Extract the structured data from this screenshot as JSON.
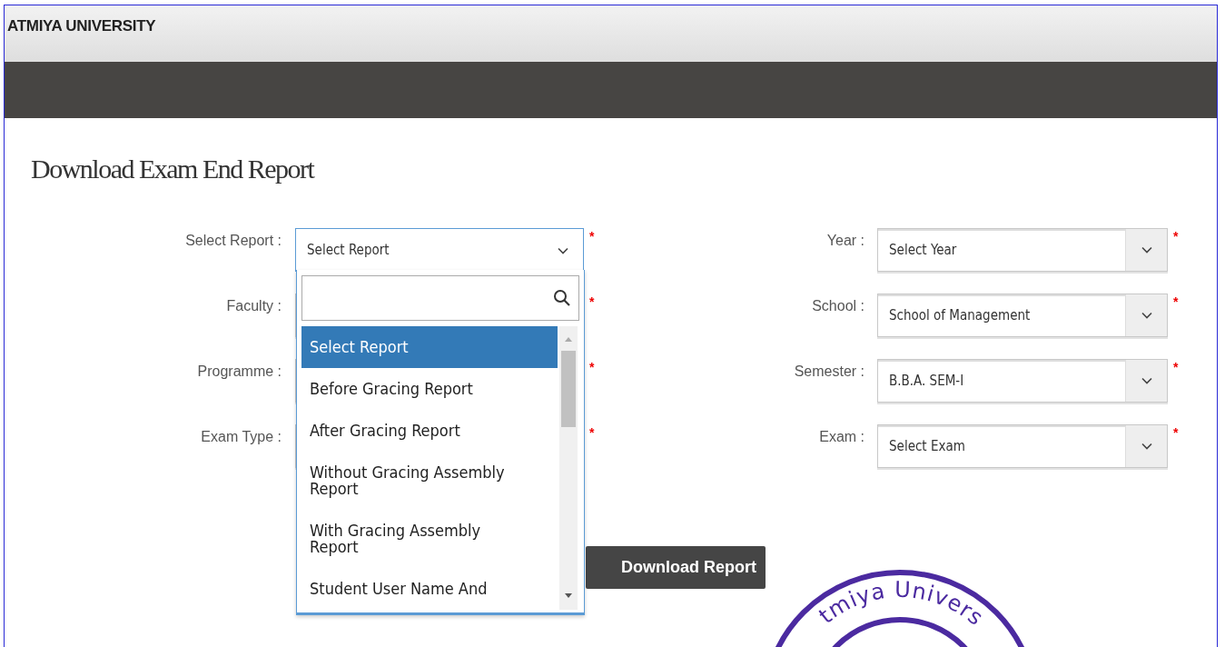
{
  "header": {
    "brand": "ATMIYA UNIVERSITY"
  },
  "page_title": "Download Exam End Report",
  "left_fields": [
    {
      "label": "Select Report :",
      "value": "Select Report",
      "required_mark": "*",
      "open": true
    },
    {
      "label": "Faculty :",
      "required_mark": "*",
      "open": false
    },
    {
      "label": "Programme :",
      "required_mark": "*",
      "open": false
    },
    {
      "label": "Exam Type :",
      "required_mark": "*",
      "open": false
    }
  ],
  "right_fields": [
    {
      "label": "Year :",
      "value": "Select Year",
      "required_mark": "*"
    },
    {
      "label": "School :",
      "value": "School of Management",
      "required_mark": "*"
    },
    {
      "label": "Semester :",
      "value": "B.B.A. SEM-I",
      "required_mark": "*"
    },
    {
      "label": "Exam :",
      "value": "Select Exam",
      "required_mark": "*"
    }
  ],
  "dropdown": {
    "options": [
      {
        "label": "Select Report",
        "selected": true
      },
      {
        "label": "Before Gracing Report",
        "selected": false
      },
      {
        "label": "After Gracing Report",
        "selected": false
      },
      {
        "label": "Without Gracing Assembly Report",
        "selected": false
      },
      {
        "label": "With Gracing Assembly Report",
        "selected": false
      },
      {
        "label": "Student User Name And",
        "selected": false
      }
    ]
  },
  "download_button": "Download Report",
  "stamp": {
    "text": "tmiya Univers"
  }
}
